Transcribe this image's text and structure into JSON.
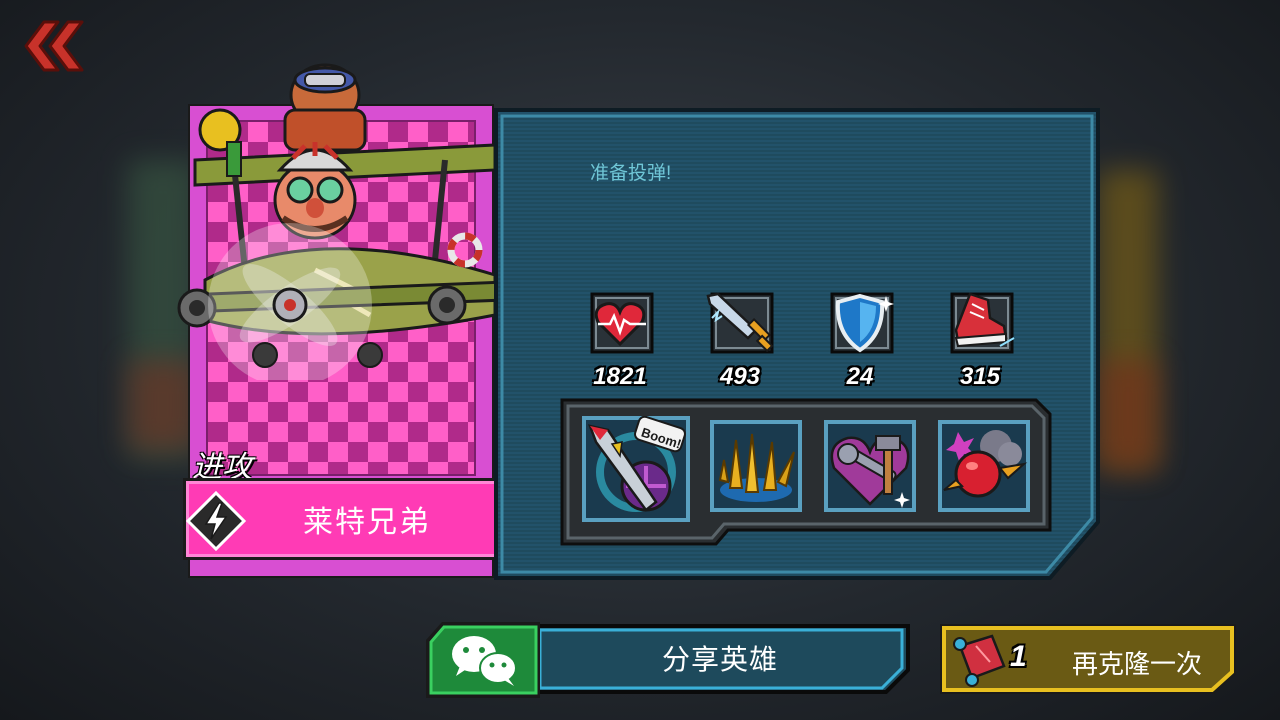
{
  "hero": {
    "class_label": "进攻",
    "name": "莱特兄弟",
    "description": "准备投弹!"
  },
  "stats": [
    {
      "icon": "heart-health-icon",
      "value": "1821"
    },
    {
      "icon": "sword-attack-icon",
      "value": "493"
    },
    {
      "icon": "shield-defense-icon",
      "value": "24"
    },
    {
      "icon": "sneaker-speed-icon",
      "value": "315"
    }
  ],
  "skills": [
    {
      "icon": "rocket-boom-skill-icon",
      "badge": "Boom!"
    },
    {
      "icon": "bullet-barrage-skill-icon"
    },
    {
      "icon": "wrench-hammer-heart-skill-icon"
    },
    {
      "icon": "red-bomb-skill-icon"
    }
  ],
  "buttons": {
    "share_label": "分享英雄",
    "clone_count": "1",
    "clone_label": "再克隆一次"
  },
  "colors": {
    "card_pink": "#ff3bb5",
    "panel_teal": "#1e4a5c",
    "panel_border": "#3d8aa6",
    "share_green": "#1e8a3a",
    "clone_gold": "#e8c020",
    "description_text": "#6fc6d6"
  }
}
